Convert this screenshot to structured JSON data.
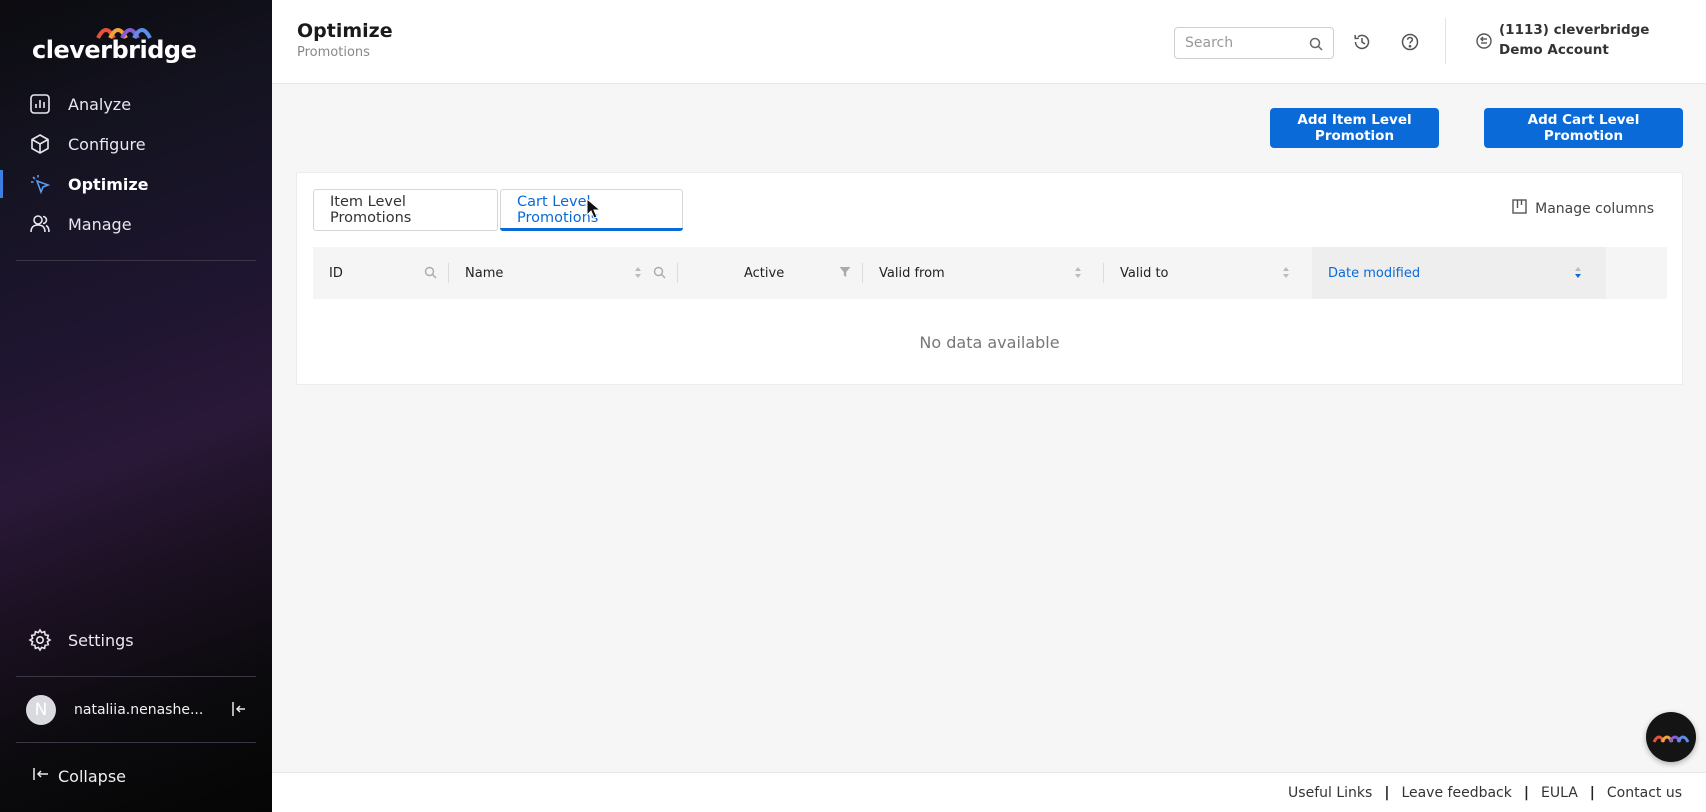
{
  "brand": {
    "logo_text": "cleverbridge",
    "accent": "#0a6ad8"
  },
  "sidebar": {
    "items": [
      {
        "label": "Analyze",
        "icon": "bar-chart-icon",
        "active": false
      },
      {
        "label": "Configure",
        "icon": "cube-icon",
        "active": false
      },
      {
        "label": "Optimize",
        "icon": "sparkle-pointer-icon",
        "active": true
      },
      {
        "label": "Manage",
        "icon": "users-icon",
        "active": false
      }
    ],
    "settings_label": "Settings",
    "user": {
      "initial": "N",
      "name": "nataliia.nenashe..."
    },
    "collapse_label": "Collapse"
  },
  "header": {
    "title": "Optimize",
    "subtitle": "Promotions",
    "search_placeholder": "Search",
    "account": "(1113) cleverbridge Demo Account"
  },
  "actions": {
    "add_item_label": "Add Item Level Promotion",
    "add_cart_label": "Add Cart Level Promotion"
  },
  "tabs": [
    {
      "label": "Item Level Promotions",
      "active": false
    },
    {
      "label": "Cart Level Promotions",
      "active": true
    }
  ],
  "manage_columns_label": "Manage columns",
  "table": {
    "columns": [
      "ID",
      "Name",
      "Active",
      "Valid from",
      "Valid to",
      "Date modified"
    ],
    "empty_message": "No data available"
  },
  "footer": {
    "links": [
      "Useful Links",
      "Leave feedback",
      "EULA",
      "Contact us"
    ]
  }
}
